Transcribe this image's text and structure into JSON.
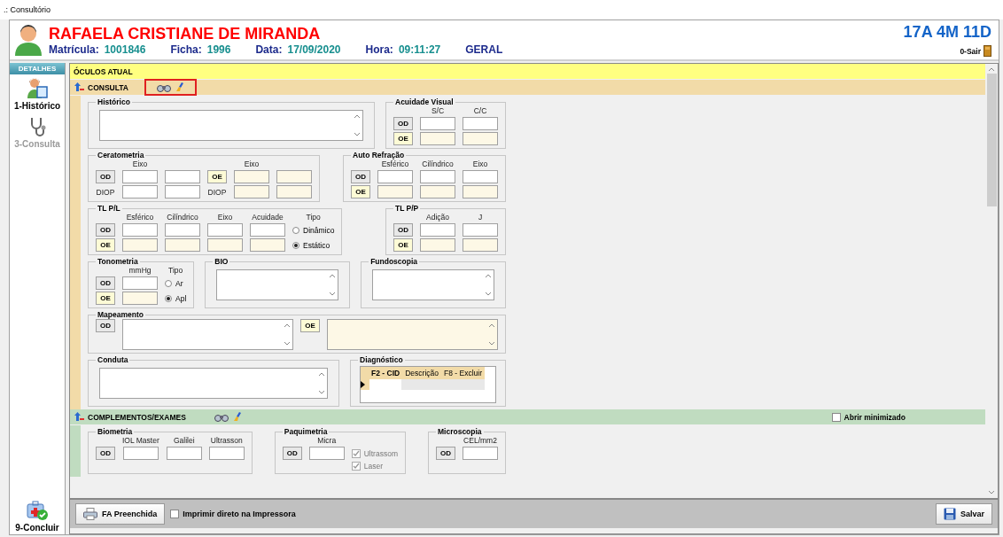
{
  "window": {
    "title": ".: Consultório"
  },
  "patient": {
    "name": "RAFAELA CRISTIANE DE MIRANDA",
    "info": [
      {
        "label": "Matrícula:",
        "value": "1001846"
      },
      {
        "label": "Ficha:",
        "value": "1996"
      },
      {
        "label": "Data:",
        "value": "17/09/2020"
      },
      {
        "label": "Hora:",
        "value": "09:11:27"
      },
      {
        "label": "GERAL"
      }
    ],
    "age": "17A 4M 11D",
    "exit": "0-Sair"
  },
  "sidebar": {
    "title": "DETALHES",
    "items": [
      {
        "label": "1-Histórico",
        "kind": "history",
        "disabled": false
      },
      {
        "label": "3-Consulta",
        "kind": "consult",
        "disabled": true
      }
    ],
    "footer_item": {
      "label": "9-Concluir",
      "kind": "finish",
      "disabled": false
    }
  },
  "sections": [
    {
      "title": "ÓCULOS ATUAL",
      "color": "#ffff80"
    },
    {
      "title": "CONSULTA",
      "color": "#f2dba8",
      "tools": true,
      "highlighted": true,
      "bands": [
        {
          "groups": [
            {
              "title": "Histórico",
              "kind": "memo"
            },
            {
              "title": "Acuidade Visual",
              "kind": "grid",
              "rows": [
                [
                  {
                    "kind": "spacer"
                  },
                  {
                    "kind": "label",
                    "text": "S/C"
                  },
                  {
                    "kind": "label",
                    "text": "C/C"
                  }
                ],
                [
                  {
                    "kind": "eye",
                    "text": "OD",
                    "tinted": false
                  },
                  {
                    "kind": "field",
                    "tinted": false
                  },
                  {
                    "kind": "field",
                    "tinted": false
                  }
                ],
                [
                  {
                    "kind": "eye",
                    "text": "OE",
                    "tinted": true
                  },
                  {
                    "kind": "field",
                    "tinted": true
                  },
                  {
                    "kind": "field",
                    "tinted": true
                  }
                ]
              ]
            }
          ]
        },
        {
          "groups": [
            {
              "title": "Ceratometria",
              "kind": "grid",
              "rows": [
                [
                  {
                    "kind": "spacer"
                  },
                  {
                    "kind": "label",
                    "text": "Eixo"
                  },
                  {
                    "kind": "spacer"
                  },
                  {
                    "kind": "spacer"
                  },
                  {
                    "kind": "label",
                    "text": "Eixo"
                  },
                  {
                    "kind": "spacer"
                  }
                ],
                [
                  {
                    "kind": "eye",
                    "text": "OD",
                    "tinted": false
                  },
                  {
                    "kind": "field",
                    "tinted": false
                  },
                  {
                    "kind": "field",
                    "tinted": false
                  },
                  {
                    "kind": "eye",
                    "text": "OE",
                    "tinted": true
                  },
                  {
                    "kind": "field",
                    "tinted": true
                  },
                  {
                    "kind": "field",
                    "tinted": true
                  }
                ],
                [
                  {
                    "kind": "label",
                    "text": "DIOP"
                  },
                  {
                    "kind": "field",
                    "tinted": false
                  },
                  {
                    "kind": "field",
                    "tinted": false
                  },
                  {
                    "kind": "label",
                    "text": "DIOP"
                  },
                  {
                    "kind": "field",
                    "tinted": true
                  },
                  {
                    "kind": "field",
                    "tinted": true
                  }
                ]
              ]
            },
            {
              "title": "Auto Refração",
              "kind": "grid",
              "rows": [
                [
                  {
                    "kind": "spacer"
                  },
                  {
                    "kind": "label",
                    "text": "Esférico"
                  },
                  {
                    "kind": "label",
                    "text": "Cilíndrico"
                  },
                  {
                    "kind": "label",
                    "text": "Eixo"
                  }
                ],
                [
                  {
                    "kind": "eye",
                    "text": "OD",
                    "tinted": false
                  },
                  {
                    "kind": "field",
                    "tinted": false
                  },
                  {
                    "kind": "field",
                    "tinted": false
                  },
                  {
                    "kind": "field",
                    "tinted": false
                  }
                ],
                [
                  {
                    "kind": "eye",
                    "text": "OE",
                    "tinted": true
                  },
                  {
                    "kind": "field",
                    "tinted": true
                  },
                  {
                    "kind": "field",
                    "tinted": true
                  },
                  {
                    "kind": "field",
                    "tinted": true
                  }
                ]
              ]
            }
          ]
        },
        {
          "groups": [
            {
              "title": "TL P/L",
              "kind": "grid",
              "rows": [
                [
                  {
                    "kind": "spacer"
                  },
                  {
                    "kind": "label",
                    "text": "Esférico"
                  },
                  {
                    "kind": "label",
                    "text": "Cilíndrico"
                  },
                  {
                    "kind": "label",
                    "text": "Eixo"
                  },
                  {
                    "kind": "label",
                    "text": "Acuidade"
                  },
                  {
                    "kind": "label",
                    "text": "Tipo"
                  }
                ],
                [
                  {
                    "kind": "eye",
                    "text": "OD",
                    "tinted": false
                  },
                  {
                    "kind": "field",
                    "tinted": false
                  },
                  {
                    "kind": "field",
                    "tinted": false
                  },
                  {
                    "kind": "field",
                    "tinted": false
                  },
                  {
                    "kind": "field",
                    "tinted": false
                  },
                  {
                    "kind": "radio",
                    "text": "Dinâmico",
                    "selected": false
                  }
                ],
                [
                  {
                    "kind": "eye",
                    "text": "OE",
                    "tinted": true
                  },
                  {
                    "kind": "field",
                    "tinted": true
                  },
                  {
                    "kind": "field",
                    "tinted": true
                  },
                  {
                    "kind": "field",
                    "tinted": true
                  },
                  {
                    "kind": "field",
                    "tinted": true
                  },
                  {
                    "kind": "radio",
                    "text": "Estático",
                    "selected": true
                  }
                ]
              ]
            },
            {
              "title": "TL P/P",
              "kind": "grid",
              "rows": [
                [
                  {
                    "kind": "spacer"
                  },
                  {
                    "kind": "label",
                    "text": "Adição"
                  },
                  {
                    "kind": "label",
                    "text": "J"
                  }
                ],
                [
                  {
                    "kind": "eye",
                    "text": "OD",
                    "tinted": false
                  },
                  {
                    "kind": "field",
                    "tinted": false
                  },
                  {
                    "kind": "field",
                    "tinted": false
                  }
                ],
                [
                  {
                    "kind": "eye",
                    "text": "OE",
                    "tinted": true
                  },
                  {
                    "kind": "field",
                    "tinted": true
                  },
                  {
                    "kind": "field",
                    "tinted": true
                  }
                ]
              ]
            }
          ]
        },
        {
          "groups": [
            {
              "title": "Tonometria",
              "kind": "grid",
              "rows": [
                [
                  {
                    "kind": "spacer"
                  },
                  {
                    "kind": "label",
                    "text": "mmHg"
                  },
                  {
                    "kind": "label",
                    "text": "Tipo"
                  }
                ],
                [
                  {
                    "kind": "eye",
                    "text": "OD",
                    "tinted": false
                  },
                  {
                    "kind": "field",
                    "tinted": false
                  },
                  {
                    "kind": "radio",
                    "text": "Ar",
                    "selected": false
                  }
                ],
                [
                  {
                    "kind": "eye",
                    "text": "OE",
                    "tinted": true
                  },
                  {
                    "kind": "field",
                    "tinted": true
                  },
                  {
                    "kind": "radio",
                    "text": "Apl",
                    "selected": true
                  }
                ]
              ]
            },
            {
              "title": "BIO",
              "kind": "memo"
            },
            {
              "title": "Fundoscopia",
              "kind": "memo"
            }
          ]
        },
        {
          "groups": [
            {
              "title": "Mapeamento",
              "kind": "grid",
              "rows": [
                [
                  {
                    "kind": "eye",
                    "text": "OD",
                    "tinted": false
                  },
                  {
                    "kind": "memo",
                    "tinted": false
                  },
                  {
                    "kind": "eye",
                    "text": "OE",
                    "tinted": true
                  },
                  {
                    "kind": "memo",
                    "tinted": true
                  }
                ]
              ]
            }
          ]
        },
        {
          "groups": [
            {
              "title": "Conduta",
              "kind": "memo"
            },
            {
              "title": "Diagnóstico",
              "kind": "table",
              "columns": [
                "F2 - CID",
                "Descrição",
                "F8 - Excluir"
              ],
              "rows": [
                {
                  "current": true
                }
              ]
            }
          ]
        }
      ]
    },
    {
      "title": "COMPLEMENTOS/EXAMES",
      "color": "#c0dcc0",
      "tools": true,
      "highlighted": false,
      "option": {
        "label": "Abrir minimizado",
        "checked": false
      },
      "bands": [
        {
          "groups": [
            {
              "title": "Biometria",
              "kind": "grid",
              "rows": [
                [
                  {
                    "kind": "spacer"
                  },
                  {
                    "kind": "label",
                    "text": "IOL Master"
                  },
                  {
                    "kind": "label",
                    "text": "Galilei"
                  },
                  {
                    "kind": "label",
                    "text": "Ultrasson"
                  }
                ],
                [
                  {
                    "kind": "eye",
                    "text": "OD",
                    "tinted": false
                  },
                  {
                    "kind": "field",
                    "tinted": false
                  },
                  {
                    "kind": "field",
                    "tinted": false
                  },
                  {
                    "kind": "field",
                    "tinted": false
                  }
                ]
              ]
            },
            {
              "title": "Paquimetria",
              "kind": "grid",
              "rows": [
                [
                  {
                    "kind": "spacer"
                  },
                  {
                    "kind": "label",
                    "text": "Micra"
                  },
                  {
                    "kind": "spacer"
                  }
                ],
                [
                  {
                    "kind": "eye",
                    "text": "OD",
                    "tinted": false
                  },
                  {
                    "kind": "field",
                    "tinted": false
                  },
                  {
                    "kind": "check",
                    "text": "Ultrassom",
                    "checked": true,
                    "disabled": true
                  }
                ],
                [
                  {
                    "kind": "spacer"
                  },
                  {
                    "kind": "spacer"
                  },
                  {
                    "kind": "check",
                    "text": "Laser",
                    "checked": true,
                    "disabled": true
                  }
                ]
              ]
            },
            {
              "title": "Microscopia",
              "kind": "grid",
              "rows": [
                [
                  {
                    "kind": "spacer"
                  },
                  {
                    "kind": "label",
                    "text": "CEL/mm2"
                  }
                ],
                [
                  {
                    "kind": "eye",
                    "text": "OD",
                    "tinted": false
                  },
                  {
                    "kind": "field",
                    "tinted": false
                  }
                ]
              ]
            }
          ]
        }
      ]
    }
  ],
  "footer": {
    "print_button": "FA Preenchida",
    "print_direct": {
      "label": "Imprimir direto na Impressora",
      "checked": false
    },
    "save_button": "Salvar"
  }
}
